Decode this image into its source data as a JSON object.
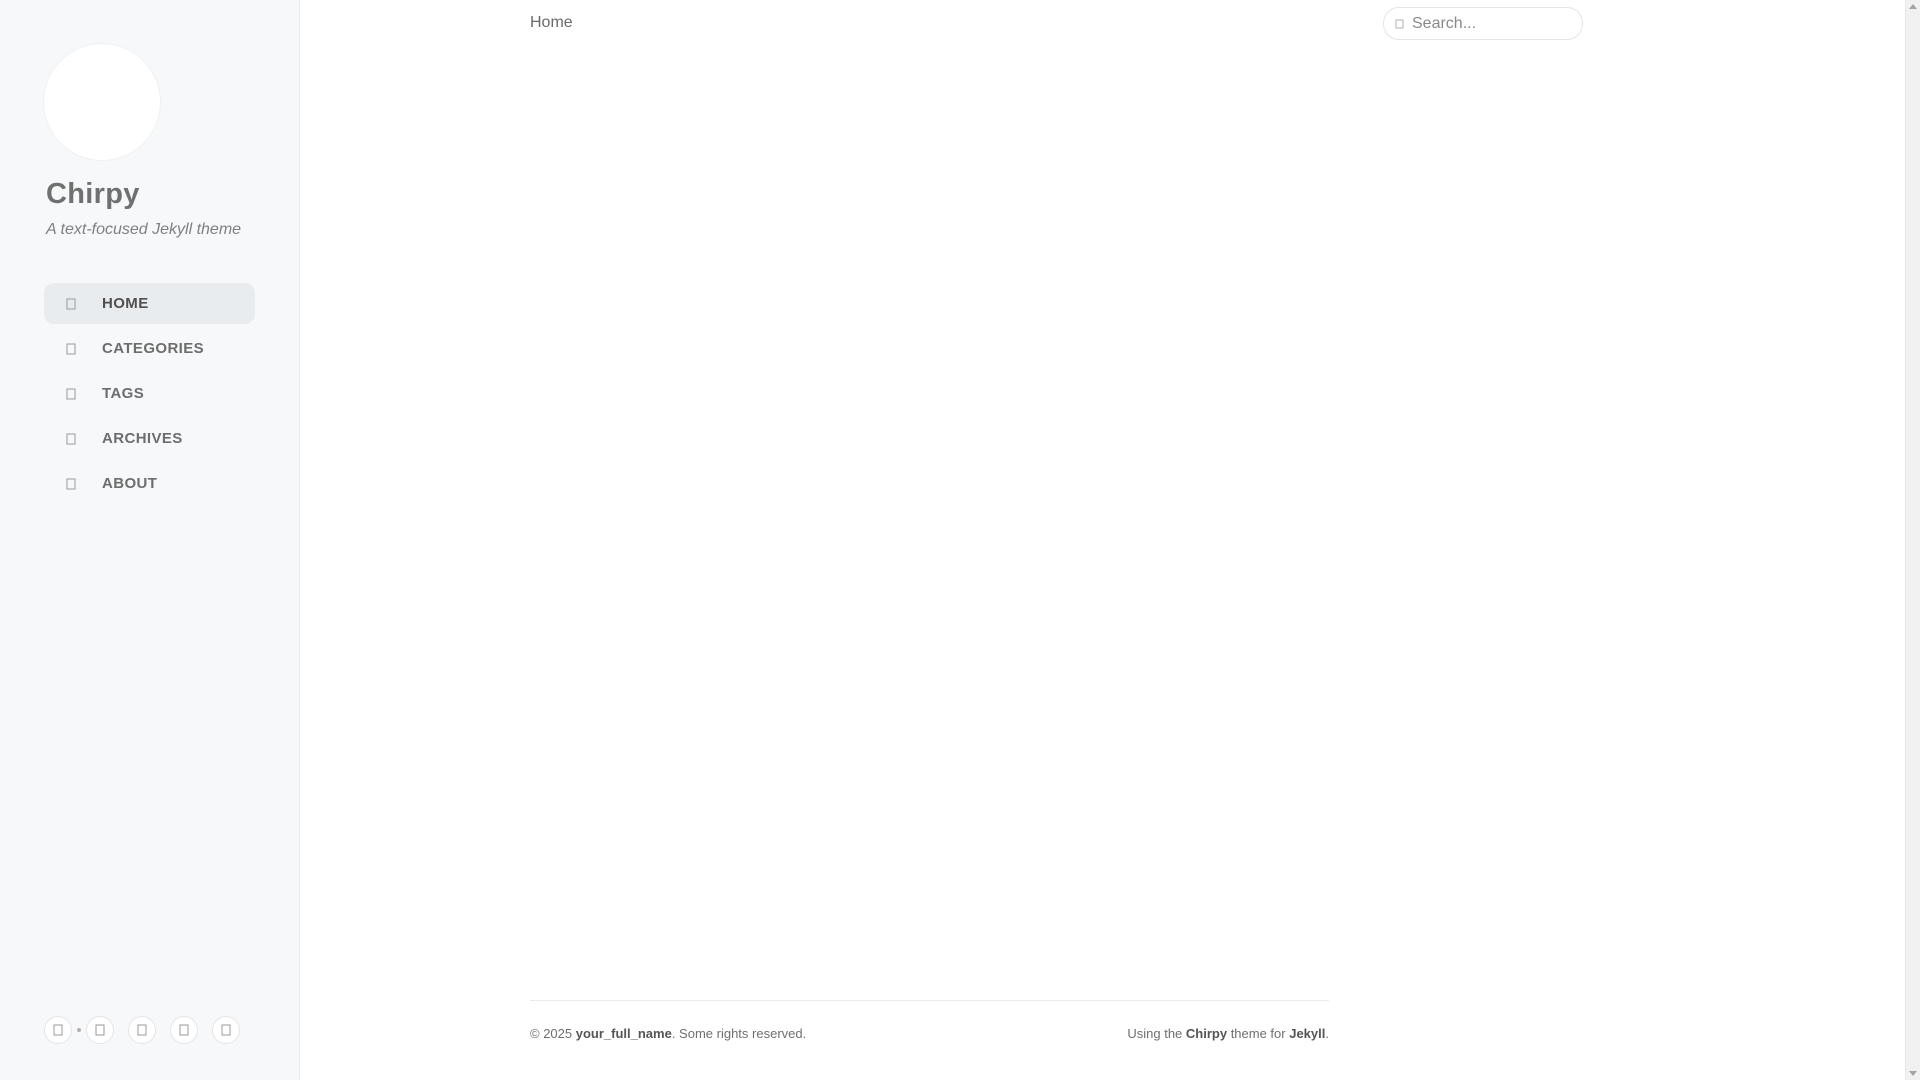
{
  "sidebar": {
    "title": "Chirpy",
    "subtitle": "A text-focused Jekyll theme",
    "nav": [
      {
        "label": "HOME",
        "icon": "home-icon",
        "active": true
      },
      {
        "label": "CATEGORIES",
        "icon": "stream-icon",
        "active": false
      },
      {
        "label": "TAGS",
        "icon": "tag-icon",
        "active": false
      },
      {
        "label": "ARCHIVES",
        "icon": "archive-icon",
        "active": false
      },
      {
        "label": "ABOUT",
        "icon": "info-icon",
        "active": false
      }
    ],
    "bottom_icons": [
      "mode-toggle-icon",
      "github-icon",
      "twitter-icon",
      "email-icon",
      "rss-icon"
    ]
  },
  "topbar": {
    "breadcrumb": "Home",
    "search_placeholder": "Search..."
  },
  "footer": {
    "copyright_prefix": "© 2025 ",
    "author": "your_full_name",
    "rights": ". Some rights reserved.",
    "using_prefix": "Using the ",
    "theme_name": "Chirpy",
    "theme_middle": " theme for ",
    "platform": "Jekyll",
    "period": "."
  },
  "colors": {
    "sidebar_bg": "#f6f8fa",
    "active_nav_bg": "#e9ecef",
    "text_muted": "#6d6d6d"
  }
}
